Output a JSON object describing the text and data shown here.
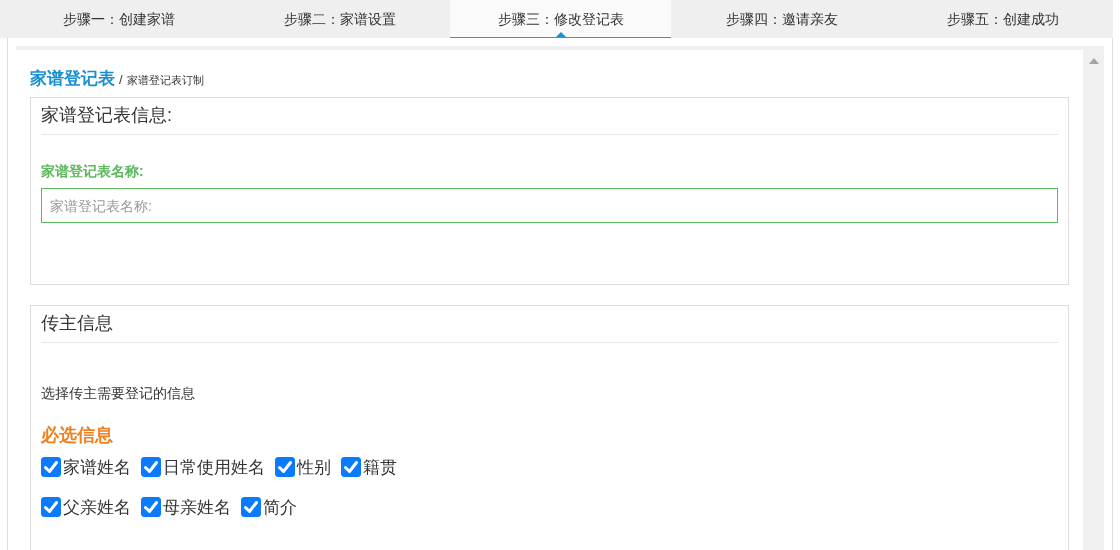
{
  "steps": [
    {
      "label": "步骤一：创建家谱",
      "selected": false
    },
    {
      "label": "步骤二：家谱设置",
      "selected": false
    },
    {
      "label": "步骤三：修改登记表",
      "selected": true
    },
    {
      "label": "步骤四：邀请亲友",
      "selected": false
    },
    {
      "label": "步骤五：创建成功",
      "selected": false
    }
  ],
  "breadcrumb": {
    "title": "家谱登记表",
    "separator": "/",
    "subtitle": "家谱登记表订制"
  },
  "form_info": {
    "heading": "家谱登记表信息:",
    "field_label": "家谱登记表名称:",
    "placeholder": "家谱登记表名称:"
  },
  "owner_info": {
    "heading": "传主信息",
    "description": "选择传主需要登记的信息",
    "required_title": "必选信息",
    "rows": [
      [
        {
          "label": "家谱姓名",
          "checked": true
        },
        {
          "label": "日常使用姓名",
          "checked": true
        },
        {
          "label": "性别",
          "checked": true
        },
        {
          "label": "籍贯",
          "checked": true
        }
      ],
      [
        {
          "label": "父亲姓名",
          "checked": true
        },
        {
          "label": "母亲姓名",
          "checked": true
        },
        {
          "label": "简介",
          "checked": true
        }
      ]
    ]
  }
}
